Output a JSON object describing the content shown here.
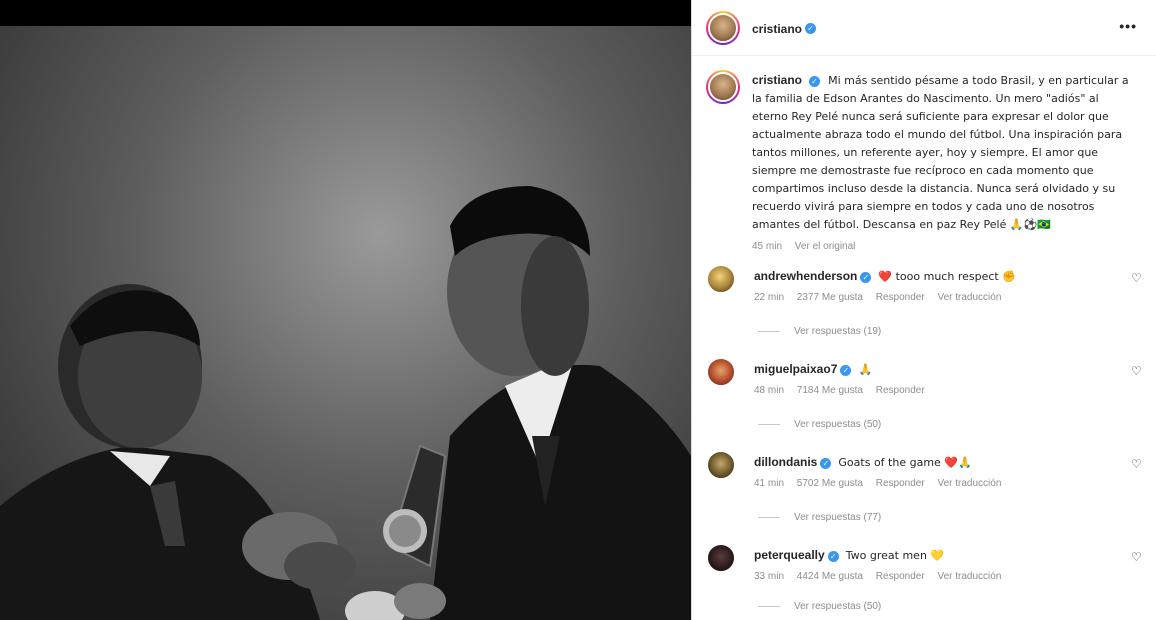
{
  "post": {
    "author": "cristiano",
    "caption_author": "cristiano",
    "caption_text": "Mi más sentido pésame a todo Brasil, y en particular a la familia de Edson Arantes do Nascimento. Un mero \"adiós\" al eterno Rey Pelé nunca será suficiente para expresar el dolor que actualmente abraza todo el mundo del fútbol. Una inspiración para tantos millones, un referente ayer, hoy y siempre. El amor que siempre me demostraste fue recíproco en cada momento que compartimos incluso desde la distancia. Nunca será olvidado y su recuerdo vivirá para siempre en todos y cada uno de nosotros amantes del fútbol. Descansa en paz Rey Pelé 🙏⚽🇧🇷",
    "caption_time": "45 min",
    "see_original": "Ver el original",
    "more_label": "•••"
  },
  "comments": [
    {
      "user": "andrewhenderson",
      "text": "❤️ tooo much respect ✊",
      "time": "22 min",
      "likes": "2377 Me gusta",
      "reply": "Responder",
      "translate": "Ver traducción",
      "replies": "Ver respuestas (19)"
    },
    {
      "user": "miguelpaixao7",
      "text": "🙏",
      "time": "48 min",
      "likes": "7184 Me gusta",
      "reply": "Responder",
      "translate": "",
      "replies": "Ver respuestas (50)"
    },
    {
      "user": "dillondanis",
      "text": "Goats of the game ❤️🙏",
      "time": "41 min",
      "likes": "5702 Me gusta",
      "reply": "Responder",
      "translate": "Ver traducción",
      "replies": "Ver respuestas (77)"
    },
    {
      "user": "peterqueally",
      "text": "Two great men 💛",
      "time": "33 min",
      "likes": "4424 Me gusta",
      "reply": "Responder",
      "translate": "Ver traducción",
      "replies": "Ver respuestas (50)"
    }
  ],
  "icons": {
    "verified": "verified-badge-icon",
    "heart": "heart-outline-icon",
    "more": "more-options-icon"
  },
  "colors": {
    "verified": "#3897f0",
    "text": "#262626",
    "muted": "#8e8e8e"
  }
}
